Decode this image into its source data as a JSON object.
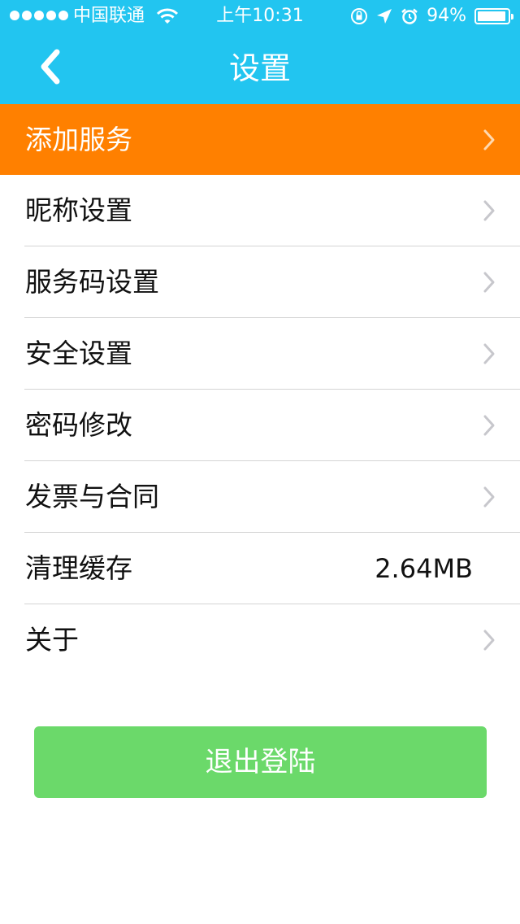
{
  "status_bar": {
    "carrier": "中国联通",
    "time": "上午10:31",
    "battery": "94%",
    "battery_level": 0.94,
    "icons": [
      "signal-dots",
      "wifi-icon",
      "orientation-lock-icon",
      "location-arrow-icon",
      "alarm-icon",
      "battery-icon"
    ]
  },
  "nav": {
    "title": "设置",
    "back_icon": "chevron-left-icon"
  },
  "settings": {
    "items": [
      {
        "label": "添加服务"
      },
      {
        "label": "昵称设置"
      },
      {
        "label": "服务码设置"
      },
      {
        "label": "安全设置"
      },
      {
        "label": "密码修改"
      },
      {
        "label": "发票与合同"
      },
      {
        "label": "清理缓存",
        "value": "2.64MB"
      },
      {
        "label": "关于"
      }
    ]
  },
  "logout": {
    "label": "退出登陆"
  },
  "colors": {
    "header": "#22c5f0",
    "highlight": "#ff8000",
    "logout": "#6bd96a",
    "chevron": "#c7c7cc"
  }
}
